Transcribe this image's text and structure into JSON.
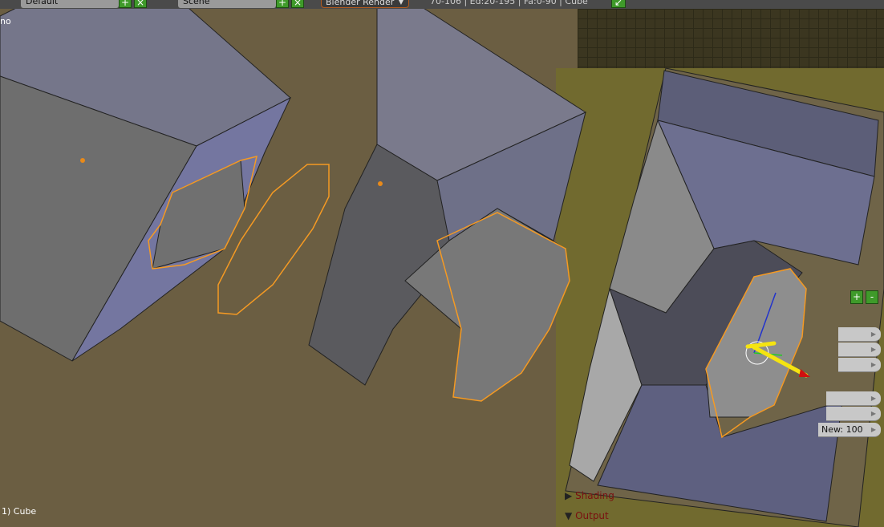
{
  "header": {
    "layout": "Default",
    "scene": "Scene",
    "engine": "Blender Render",
    "stats": "70-106 | Ed:20-195 | Fa:0-90 | Cube"
  },
  "viewport": {
    "view_label": "no",
    "object_label": "1) Cube"
  },
  "properties": {
    "new_value": "New: 100",
    "plus": "+",
    "minus": "-",
    "sections": [
      "Shading",
      "Output"
    ]
  },
  "icons": {
    "add": "plus-icon",
    "remove": "x-icon",
    "dropdown": "chevron-down-icon",
    "expand": "triangle-right-icon",
    "collapse": "triangle-down-icon"
  },
  "colors": {
    "selection": "#f59a23",
    "mesh_face": "#6f7086",
    "background": "#6b5e42",
    "panel": "#716a2f"
  }
}
